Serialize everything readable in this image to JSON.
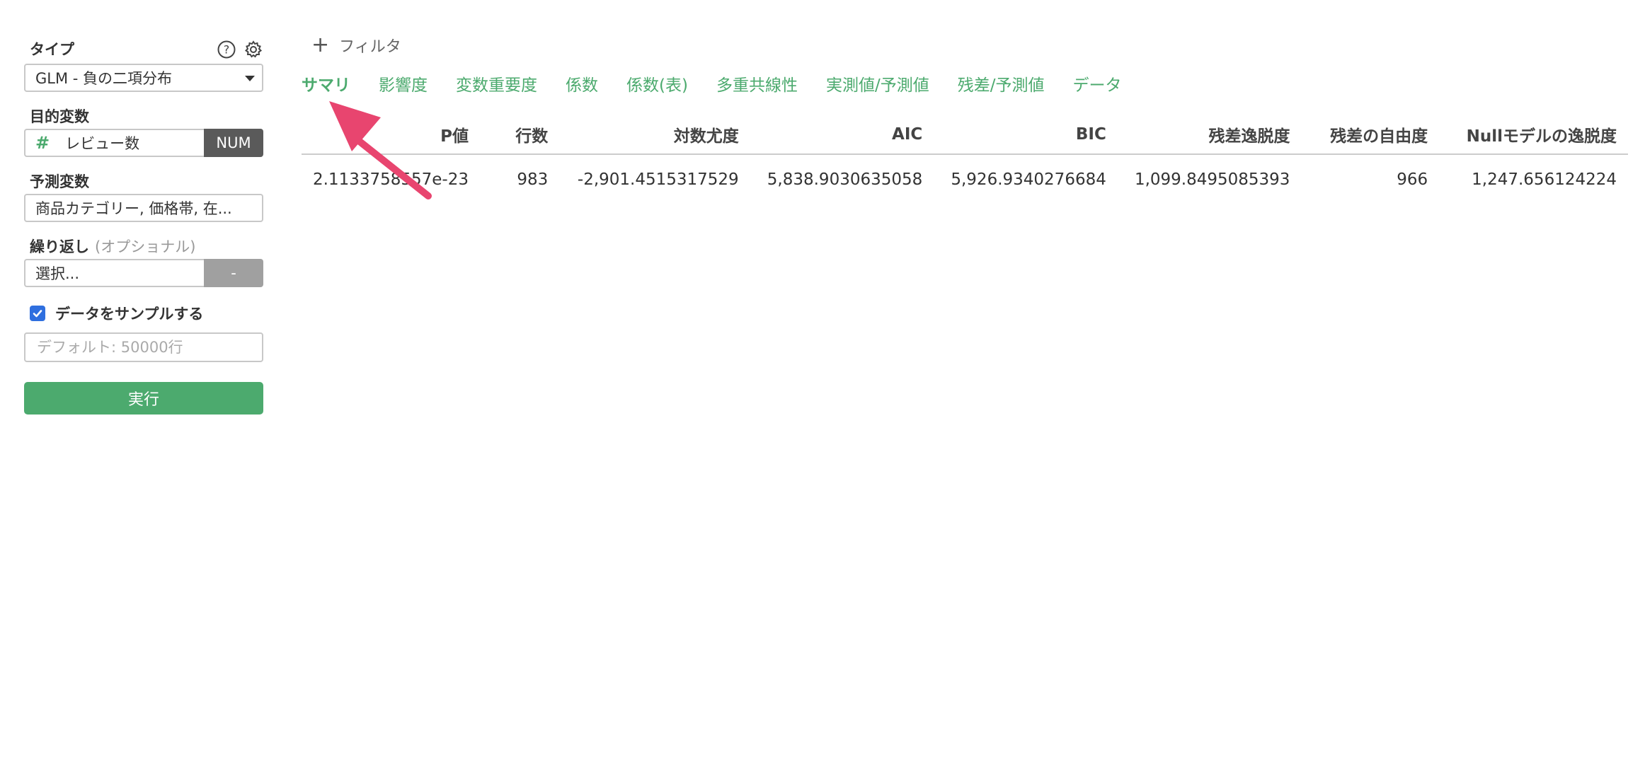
{
  "sidebar": {
    "type_label": "タイプ",
    "type_value": "GLM - 負の二項分布",
    "target_label": "目的変数",
    "target_value": "レビュー数",
    "target_badge": "NUM",
    "predictor_label": "予測変数",
    "predictor_value": "商品カテゴリー, 価格帯, 在...",
    "repeat_label": "繰り返し",
    "repeat_optional": "(オプショナル)",
    "repeat_value": "選択...",
    "repeat_badge": "-",
    "sample_label": "データをサンプルする",
    "sample_checked": true,
    "sample_placeholder": "デフォルト: 50000行",
    "run_label": "実行",
    "icons": [
      "help-icon",
      "gear-icon"
    ]
  },
  "main": {
    "filter_label": "フィルタ",
    "tabs": [
      {
        "label": "サマリ",
        "active": true
      },
      {
        "label": "影響度"
      },
      {
        "label": "変数重要度"
      },
      {
        "label": "係数"
      },
      {
        "label": "係数(表)"
      },
      {
        "label": "多重共線性"
      },
      {
        "label": "実測値/予測値"
      },
      {
        "label": "残差/予測値"
      },
      {
        "label": "データ"
      }
    ],
    "table": {
      "headers": [
        "P値",
        "行数",
        "対数尤度",
        "AIC",
        "BIC",
        "残差逸脱度",
        "残差の自由度",
        "Nullモデルの逸脱度"
      ],
      "row": [
        "2.1133758557e-23",
        "983",
        "-2,901.4515317529",
        "5,838.9030635058",
        "5,926.9340276684",
        "1,099.8495085393",
        "966",
        "1,247.656124224"
      ]
    }
  },
  "colors": {
    "accent": "#4caa6e",
    "annotation_arrow": "#e8456f",
    "badge_dark": "#5a5a5a",
    "checkbox": "#2f6fdf"
  }
}
